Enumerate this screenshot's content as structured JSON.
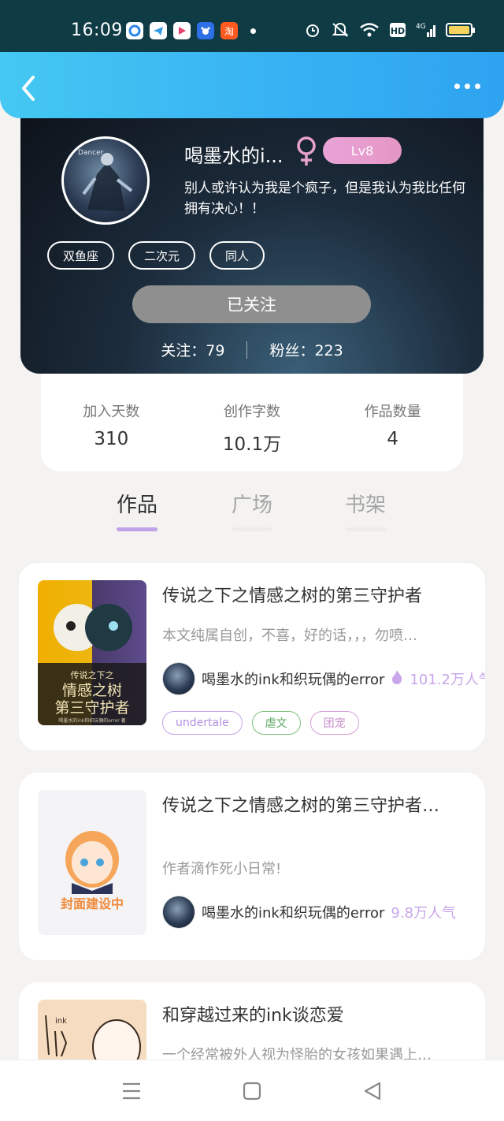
{
  "status_bar": {
    "time": "16:09",
    "apps": [
      {
        "icon": "app-blue-icon",
        "color": "#2f86e8"
      },
      {
        "icon": "app-telegram-icon",
        "color": "#2e9be6"
      },
      {
        "icon": "app-video-icon",
        "color": "#e8416b"
      },
      {
        "icon": "app-baidu-icon",
        "color": "#2c6fe6"
      },
      {
        "icon": "app-taobao-icon",
        "color": "#ff5a1f",
        "text": "淘"
      }
    ],
    "battery_color": "#f4d35e"
  },
  "header": {
    "back_icon": "back-chevron-icon",
    "more_icon": "more-dots-icon",
    "gradient": [
      "#45c8f2",
      "#2ea3f0"
    ]
  },
  "profile": {
    "nickname": "喝墨水的i...",
    "gender": "female",
    "level": "Lv8",
    "bio": "别人或许认为我是个疯子，但是我认为我比任何\n拥有决心！！",
    "tags": [
      "双鱼座",
      "二次元",
      "同人"
    ],
    "follow_button": "已关注",
    "following_label": "关注：79",
    "followers_label": "粉丝：223"
  },
  "stats": [
    {
      "label": "加入天数",
      "value": "310"
    },
    {
      "label": "创作字数",
      "value": "10.1万"
    },
    {
      "label": "作品数量",
      "value": "4"
    }
  ],
  "tabs": [
    {
      "label": "作品",
      "active": true
    },
    {
      "label": "广场",
      "active": false
    },
    {
      "label": "书架",
      "active": false
    }
  ],
  "works": [
    {
      "title": "传说之下之情感之树的第三守护者",
      "desc": "本文纯属自创，不喜，好的话，，，勿喷…",
      "author": "喝墨水的ink和织玩偶的error",
      "popularity": "101.2万人气",
      "hot": true,
      "cover_text": [
        "传说之下之",
        "情感之树",
        "第三守护者"
      ],
      "cover_subtext": "喝墨水的ink和织玩偶的error 著",
      "tags": [
        {
          "label": "undertale",
          "color": "#c4a5e8"
        },
        {
          "label": "虐文",
          "color": "#7bc07e"
        },
        {
          "label": "团宠",
          "color": "#d79fd9"
        }
      ]
    },
    {
      "title": "传说之下之情感之树的第三守护者…",
      "desc": "作者滴作死小日常!",
      "author": "喝墨水的ink和织玩偶的error",
      "popularity": "9.8万人气",
      "hot": false,
      "cover_text": [
        "封面建设中"
      ]
    },
    {
      "title": "和穿越过来的ink谈恋爱",
      "desc": "一个经常被外人视为怪胎的女孩如果遇上…",
      "cover_text": [
        "ink"
      ]
    }
  ],
  "nav": {
    "menu_icon": "menu-icon",
    "home_icon": "home-square-icon",
    "back_icon": "back-triangle-icon"
  }
}
